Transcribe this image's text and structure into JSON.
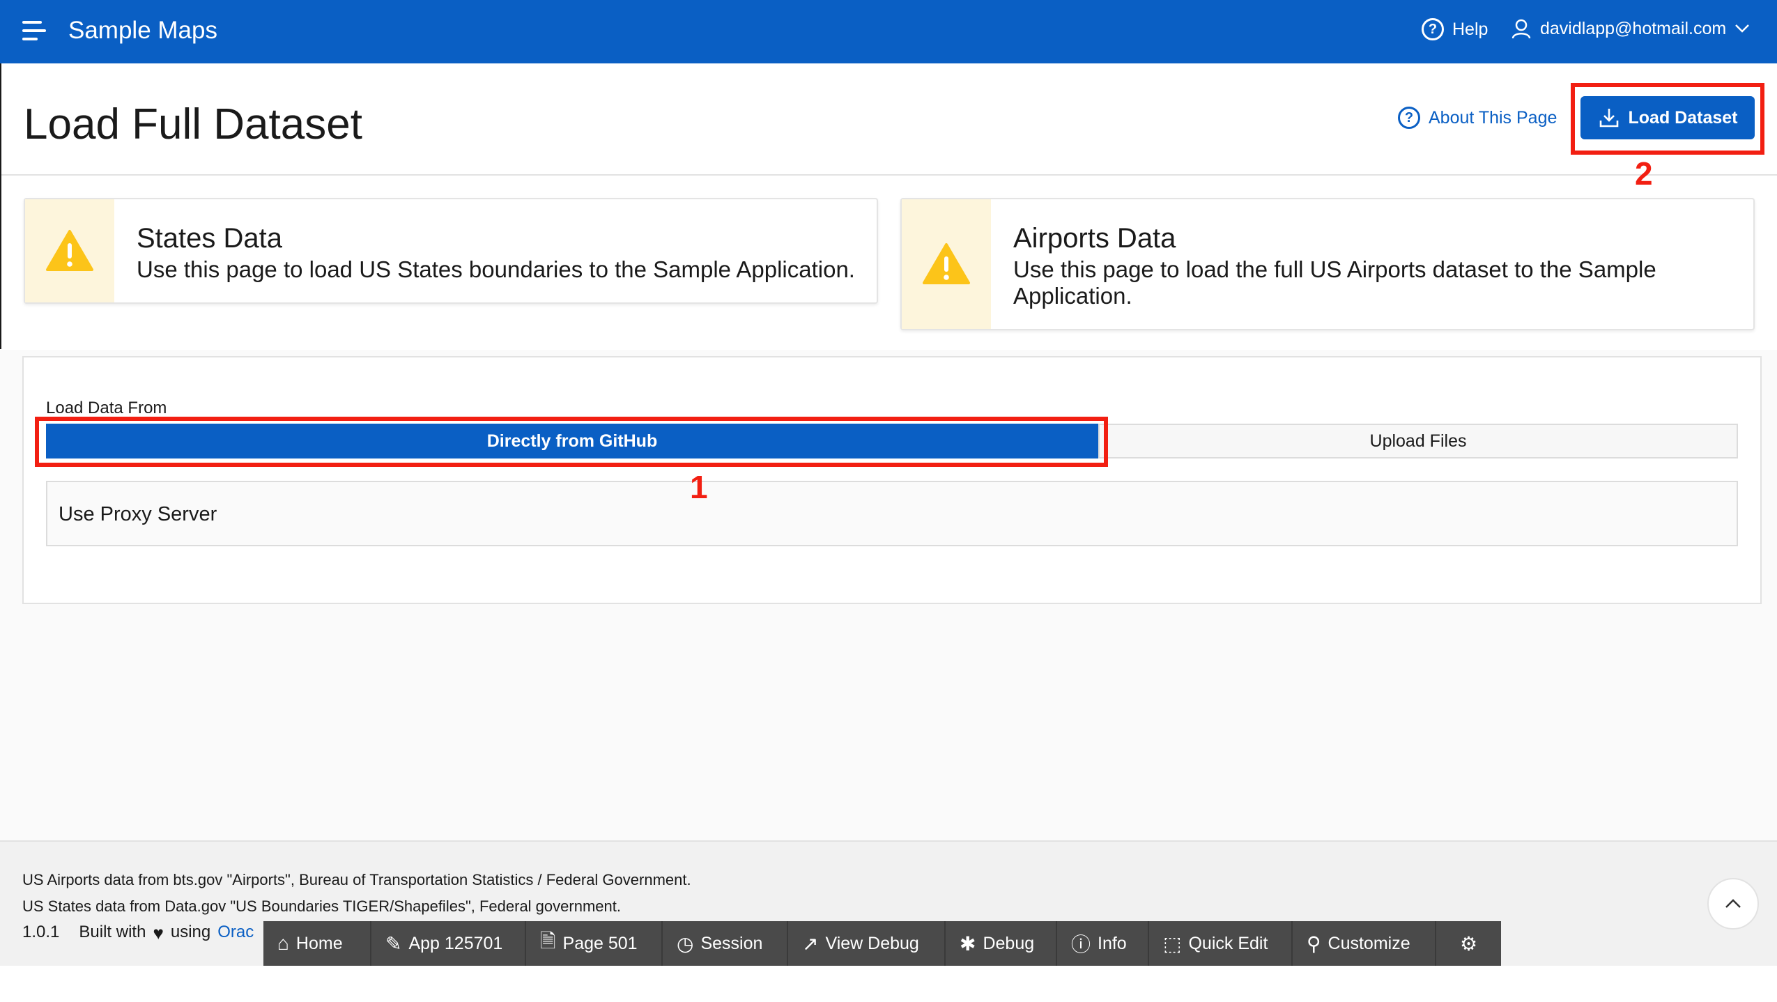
{
  "header": {
    "app_title": "Sample Maps",
    "help_label": "Help",
    "user_email": "davidlapp@hotmail.com"
  },
  "page": {
    "title": "Load Full Dataset",
    "about_link": "About This Page",
    "load_button": "Load Dataset"
  },
  "annotations": {
    "marker_1": "1",
    "marker_2": "2"
  },
  "cards": [
    {
      "title": "States Data",
      "body": "Use this page to load US States boundaries to the Sample Application."
    },
    {
      "title": "Airports Data",
      "body": "Use this page to load the full US Airports dataset to the Sample Application."
    }
  ],
  "form": {
    "label": "Load Data From",
    "options": [
      "Directly from GitHub",
      "Upload Files"
    ],
    "selected": "Directly from GitHub",
    "proxy_label": "Use Proxy Server"
  },
  "footer": {
    "line1": "US Airports data from bts.gov \"Airports\", Bureau of Transportation Statistics / Federal Government.",
    "line2": "US States data from Data.gov \"US Boundaries TIGER/Shapefiles\", Federal government.",
    "version": "1.0.1",
    "built_with": "Built with",
    "using": "using",
    "oracle_link": "Orac"
  },
  "devbar": {
    "home": "Home",
    "app": "App 125701",
    "page": "Page 501",
    "session": "Session",
    "view_debug": "View Debug",
    "debug": "Debug",
    "info": "Info",
    "quick_edit": "Quick Edit",
    "customize": "Customize"
  },
  "colors": {
    "brand": "#0a5fc4",
    "annotation": "#f21f12",
    "warning": "#fcc419"
  }
}
